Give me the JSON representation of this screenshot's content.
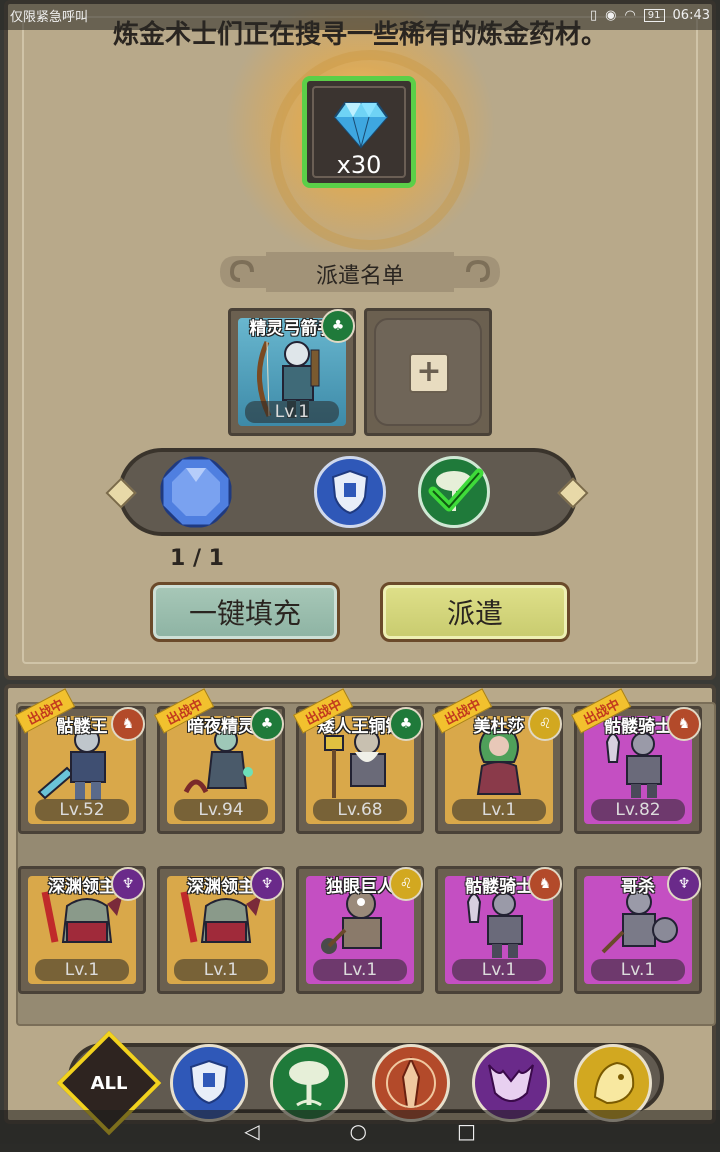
{
  "status_bar": {
    "carrier": "仅限紧急呼叫",
    "battery": "91",
    "time": "06:43"
  },
  "headline": "炼金术士们正在搜寻一些稀有的炼金药材。",
  "reward": {
    "icon": "diamond-icon",
    "quantity": "x30"
  },
  "dispatch": {
    "title": "派遣名单",
    "selected": {
      "name": "精灵弓箭手",
      "level": "Lv.1",
      "faction_icon": "tree-faction-icon"
    },
    "empty_slot_icon": "plus-icon"
  },
  "requirements": {
    "gem_icon": "blue-gem-icon",
    "count": "1 / 1",
    "faction_icon": "shield-faction-icon",
    "met_icon": "check-icon"
  },
  "buttons": {
    "auto_fill": "一键填充",
    "dispatch": "派遣"
  },
  "roster": [
    {
      "name": "骷髅王",
      "level": "Lv.52",
      "tag": "出战中",
      "faction": "beast",
      "color": "#d9a84a"
    },
    {
      "name": "暗夜精灵",
      "level": "Lv.94",
      "tag": "出战中",
      "faction": "tree",
      "color": "#d9a84a"
    },
    {
      "name": "矮人王铜锤",
      "level": "Lv.68",
      "tag": "出战中",
      "faction": "tree",
      "color": "#d9a84a"
    },
    {
      "name": "美杜莎",
      "level": "Lv.1",
      "tag": "出战中",
      "faction": "lion",
      "color": "#d9a84a"
    },
    {
      "name": "骷髅骑士",
      "level": "Lv.82",
      "tag": "出战中",
      "faction": "beast",
      "color": "#c44fc2"
    },
    {
      "name": "深渊领主",
      "level": "Lv.1",
      "tag": "",
      "faction": "demon",
      "color": "#d9a84a"
    },
    {
      "name": "深渊领主",
      "level": "Lv.1",
      "tag": "",
      "faction": "demon",
      "color": "#d9a84a"
    },
    {
      "name": "独眼巨人",
      "level": "Lv.1",
      "tag": "",
      "faction": "lion",
      "color": "#c44fc2"
    },
    {
      "name": "骷髅骑士",
      "level": "Lv.1",
      "tag": "",
      "faction": "beast",
      "color": "#c44fc2"
    },
    {
      "name": "哥杀",
      "level": "Lv.1",
      "tag": "",
      "faction": "demon",
      "color": "#c44fc2"
    }
  ],
  "filters": {
    "all_label": "ALL",
    "items": [
      "shield-faction-icon",
      "tree-faction-icon",
      "beast-faction-icon",
      "demon-faction-icon",
      "lion-faction-icon"
    ]
  },
  "colors": {
    "panel": "#b8a98a",
    "border": "#4a4238",
    "reward_border": "#5bcf48",
    "faction_shield": "#2f58b8",
    "faction_tree": "#1f7a3a",
    "faction_beast": "#b34a2a",
    "faction_demon": "#6a2a8a",
    "faction_lion": "#d2a820"
  },
  "nav_bar": {
    "back": "◁",
    "home": "○",
    "recent": "□"
  }
}
